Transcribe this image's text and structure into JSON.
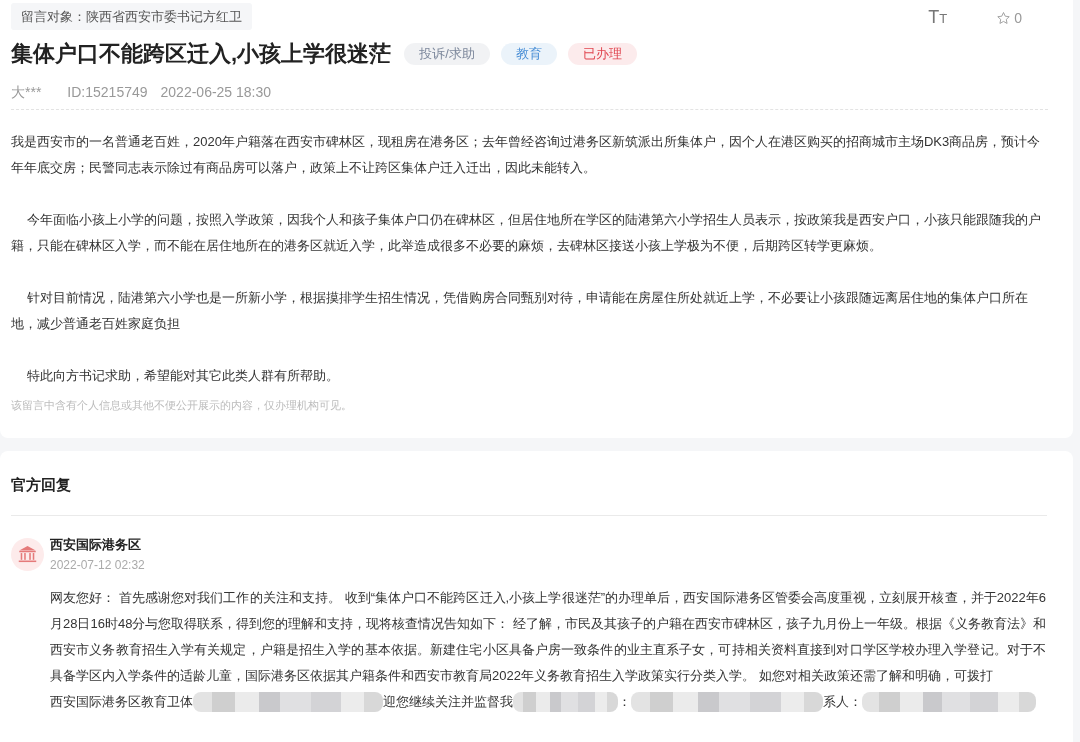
{
  "message_target": "留言对象：陕西省西安市委书记方红卫",
  "toolbar": {
    "font_size": "TT",
    "starred": false,
    "favorites": "0"
  },
  "title": "集体户口不能跨区迁入,小孩上学很迷茫",
  "tags": [
    {
      "label": "投诉/求助",
      "color": "#7d889c"
    },
    {
      "label": "教育",
      "color": "#4a8fd6"
    },
    {
      "label": "已办理",
      "color": "#e0454f"
    }
  ],
  "meta": {
    "author": "大***",
    "id": "ID:15215749",
    "time": "2022-06-25 18:30"
  },
  "paragraphs": [
    {
      "text": "我是西安市的一名普通老百姓，2020年户籍落在西安市碑林区，现租房在港务区；去年曾经咨询过港务区新筑派出所集体户，因个人在港区购买的招商城市主场DK3商品房，预计今年年底交房；民警同志表示除过有商品房可以落户，政策上不让跨区集体户迁入迁出，因此未能转入。",
      "indented": false
    },
    {
      "text": "今年面临小孩上小学的问题，按照入学政策，因我个人和孩子集体户口仍在碑林区，但居住地所在学区的陆港第六小学招生人员表示，按政策我是西安户口，小孩只能跟随我的户籍，只能在碑林区入学，而不能在居住地所在的港务区就近入学，此举造成很多不必要的麻烦，去碑林区接送小孩上学极为不便，后期跨区转学更麻烦。",
      "indented": true
    },
    {
      "text": "针对目前情况，陆港第六小学也是一所新小学，根据摸排学生招生情况，凭借购房合同甄别对待，申请能在房屋住所处就近上学，不必要让小孩跟随远离居住地的集体户口所在地，减少普通老百姓家庭负担",
      "indented": true
    },
    {
      "text": "特此向方书记求助，希望能对其它此类人群有所帮助。",
      "indented": true
    }
  ],
  "privacy_note": "该留言中含有个人信息或其他不便公开展示的内容，仅办理机构可见。",
  "official_reply": {
    "heading": "官方回复",
    "replier": "西安国际港务区",
    "time": "2022-07-12 02:32",
    "body": "网友您好： 首先感谢您对我们工作的关注和支持。 收到“集体户口不能跨区迁入,小孩上学很迷茫”的办理单后，西安国际港务区管委会高度重视，立刻展开核查，并于2022年6月28日16时48分与您取得联系，得到您的理解和支持，现将核查情况告知如下： 经了解，市民及其孩子的户籍在西安市碑林区，孩子九月份上一年级。根据《义务教育法》和西安市义务教育招生入学有关规定，户籍是招生入学的基本依据。新建住宅小区具备户房一致条件的业主直系子女，可持相关资料直接到对口学区学校办理入学登记。对于不具备学区内入学条件的适龄儿童，国际港务区依据其户籍条件和西安市教育局2022年义务教育招生入学政策实行分类入学。 如您对相关政策还需了解和明确，可拨打",
    "last_line": [
      {
        "kind": "text",
        "text": "西安国际港务区教育卫体"
      },
      {
        "kind": "blur"
      },
      {
        "kind": "text",
        "text": "迎您继续关注并监督我"
      },
      {
        "kind": "blur"
      },
      {
        "kind": "text",
        "text": "："
      },
      {
        "kind": "blur"
      },
      {
        "kind": "text",
        "text": "系人："
      },
      {
        "kind": "blur"
      }
    ]
  }
}
